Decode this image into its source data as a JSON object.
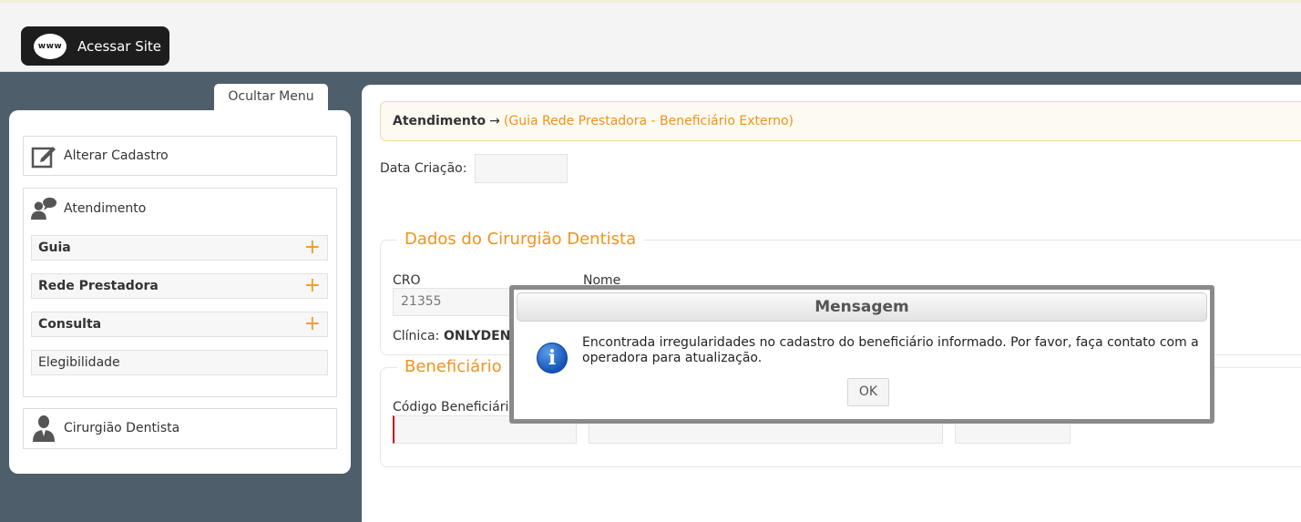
{
  "header": {
    "site_button_icon_text": "www",
    "site_button_label": "Acessar Site"
  },
  "sidebar": {
    "toggle_label": "Ocultar Menu",
    "items": [
      {
        "label": "Alterar Cadastro",
        "icon": "edit-icon"
      },
      {
        "label": "Atendimento",
        "icon": "user-chat-icon",
        "children": [
          {
            "label": "Guia",
            "expand": "+"
          },
          {
            "label": "Rede Prestadora",
            "expand": "+"
          },
          {
            "label": "Consulta",
            "expand": "+"
          },
          {
            "label": "Elegibilidade"
          }
        ]
      },
      {
        "label": "Cirurgião Dentista",
        "icon": "dentist-icon"
      }
    ]
  },
  "breadcrumb": {
    "section": "Atendimento",
    "arrow": "→",
    "page": "(Guia Rede Prestadora - Beneficiário Externo)"
  },
  "form": {
    "date_label": "Data Criação:",
    "date_value": "",
    "dentist_section": {
      "legend": "Dados do Cirurgião Dentista",
      "cro_label": "CRO",
      "cro_value": "21355",
      "name_label": "Nome",
      "clinic_label": "Clínica:",
      "clinic_value": "ONLYDEN"
    },
    "beneficiary_section": {
      "legend": "Beneficiário",
      "code_label": "Código Beneficiário"
    }
  },
  "modal": {
    "title": "Mensagem",
    "message": "Encontrada irregularidades no cadastro do beneficiário informado. Por favor, faça contato com a operadora para atualização.",
    "ok_label": "OK",
    "icon": "info-icon"
  },
  "colors": {
    "accent": "#f0921e",
    "sidebar_bg": "#4e5e6b",
    "modal_border": "#8a8a8a"
  }
}
